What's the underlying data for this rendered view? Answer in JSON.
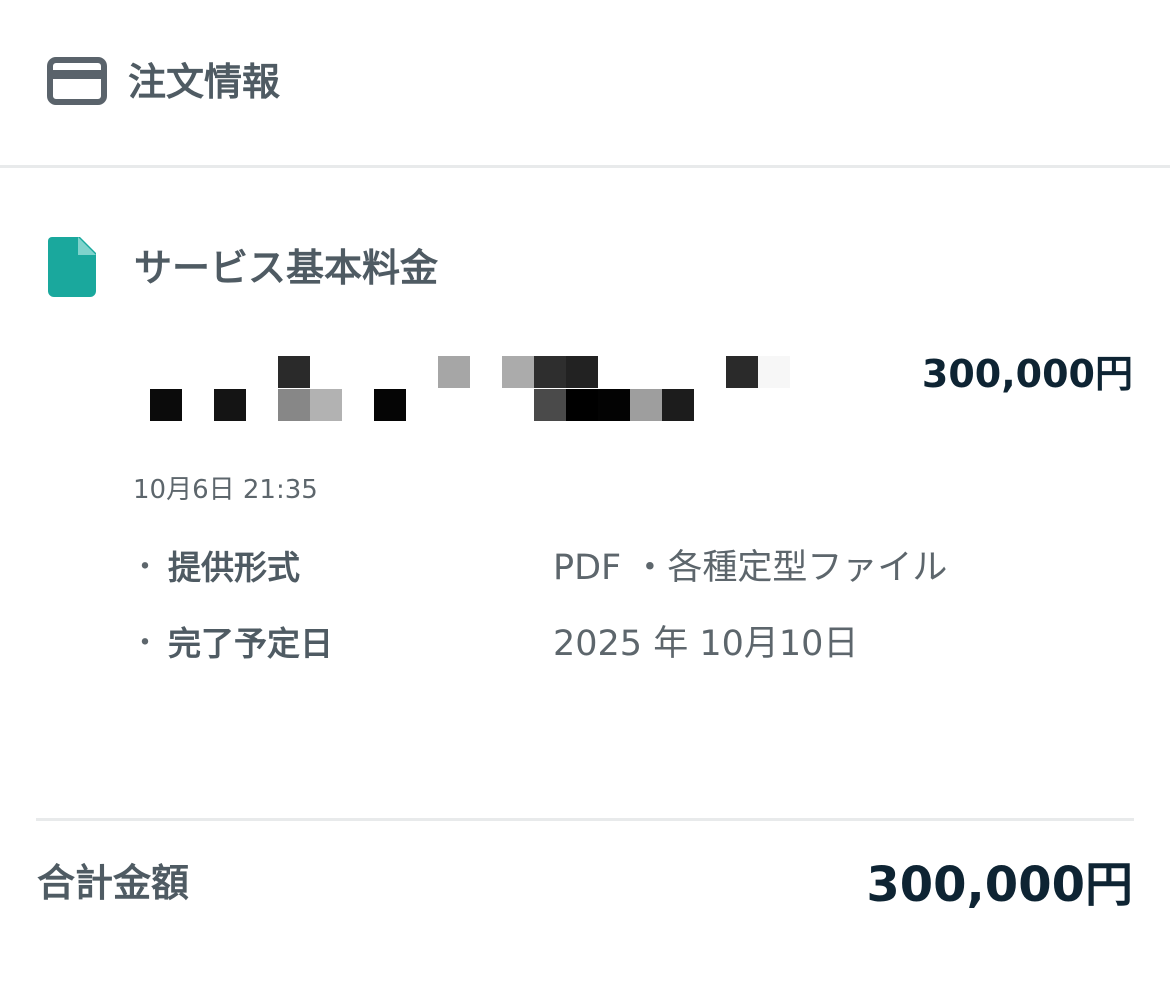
{
  "header": {
    "icon": "credit-card-icon",
    "title": "注文情報"
  },
  "item": {
    "icon": "document-icon",
    "icon_color": "#1aa89d",
    "title": "サービス基本料金",
    "price": "300,000円",
    "date": "10月6日 21:35",
    "specs": [
      {
        "bullet": "・",
        "label": "提供形式",
        "value": "PDF ・各種定型ファイル"
      },
      {
        "bullet": "・",
        "label": "完了予定日",
        "value": "2025 年 10月10日"
      }
    ]
  },
  "total": {
    "label": "合計金額",
    "amount": "300,000円"
  },
  "colors": {
    "text_primary": "#4f5b63",
    "text_dark": "#0e2433",
    "divider": "#e8eaeb",
    "accent": "#1aa89d"
  }
}
